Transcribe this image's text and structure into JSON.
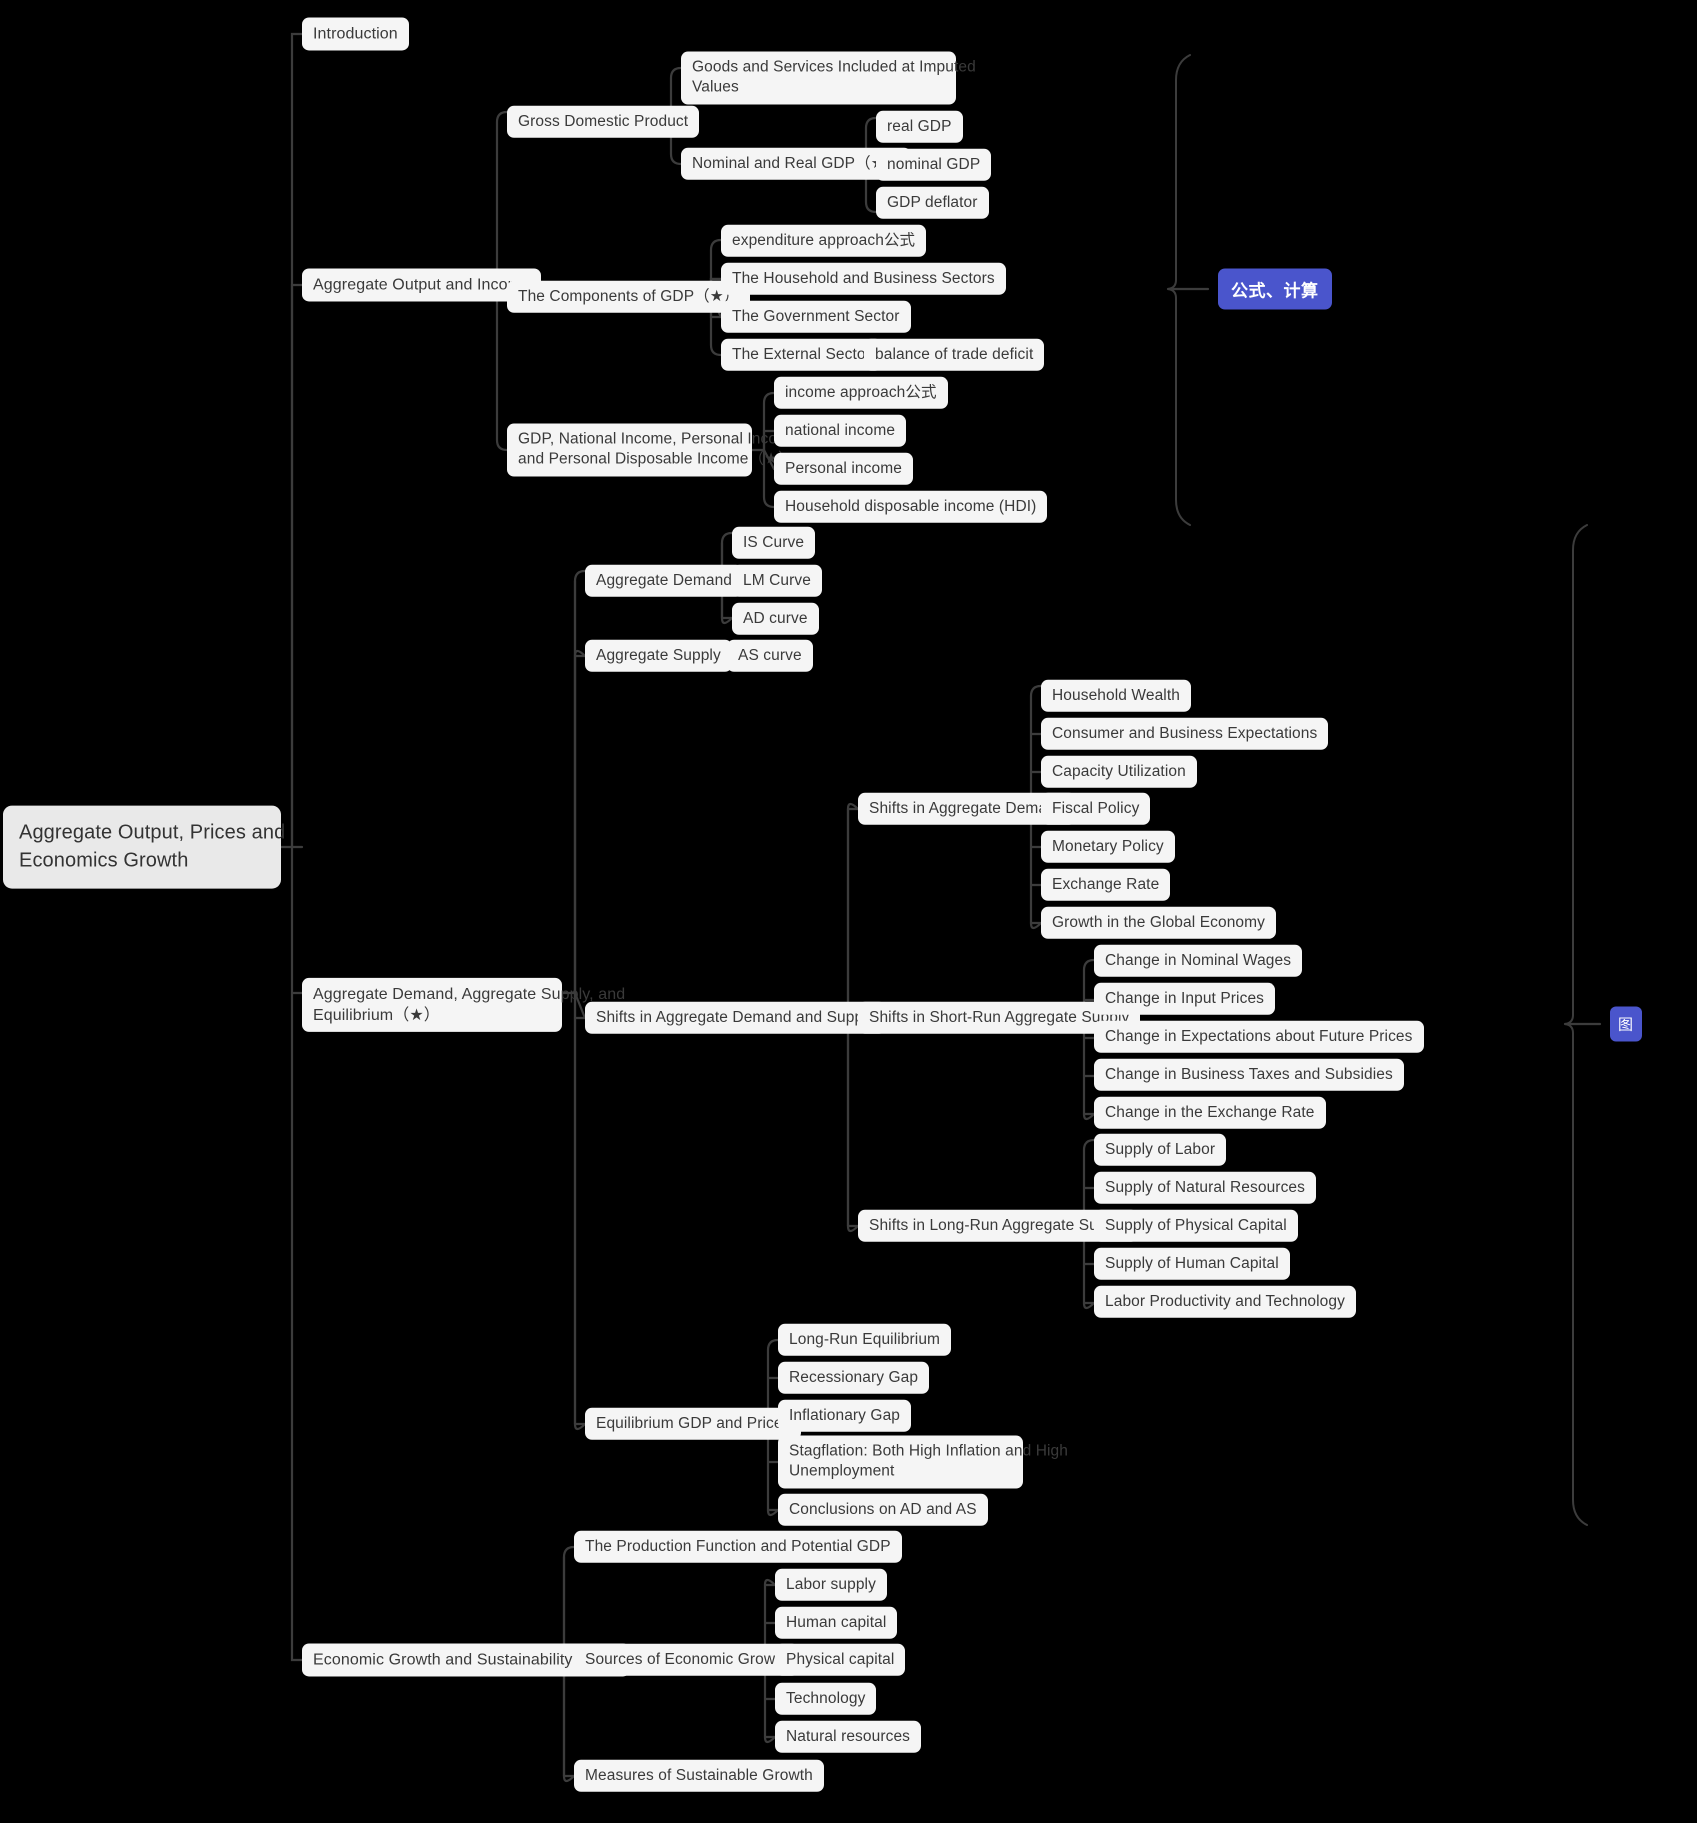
{
  "diagram": {
    "type": "mindmap",
    "background_color": "#000000",
    "node_fill": "#f5f5f5",
    "root_fill": "#e9e9e9",
    "text_color": "#3a3a3a",
    "link_color": "#3c3c3c",
    "badge_color": "#4a55cc",
    "badge_text_color": "#ffffff"
  },
  "root": {
    "label": "Aggregate Output, Prices and\nEconomics Growth"
  },
  "nodes": {
    "introduction": "Introduction",
    "aggregate_output_income": "Aggregate Output and Income",
    "gross_domestic_product": "Gross Domestic Product",
    "goods_services_imputed": "Goods and Services Included at Imputed\nValues",
    "nominal_real_gdp": "Nominal and Real GDP（★）",
    "real_gdp": "real GDP",
    "nominal_gdp": "nominal GDP",
    "gdp_deflator": "GDP deflator",
    "components_of_gdp": "The Components of GDP（★）",
    "expenditure_approach": "expenditure approach公式",
    "household_business_sectors": "The Household and Business Sectors",
    "government_sector": "The Government Sector",
    "external_sector": "The External Sector",
    "balance_of_trade_deficit": "balance of trade deficit",
    "gdp_national_personal": "GDP, National Income, Personal Income,\nand Personal Disposable Income（★）",
    "income_approach": "income approach公式",
    "national_income": "national income",
    "personal_income": "Personal income",
    "household_disposable_income": "Household disposable income (HDI)",
    "ad_as_equilibrium": "Aggregate Demand, Aggregate Supply, and\nEquilibrium（★）",
    "aggregate_demand": "Aggregate Demand",
    "is_curve": "IS Curve",
    "lm_curve": "LM Curve",
    "ad_curve": "AD curve",
    "aggregate_supply": "Aggregate Supply",
    "as_curve": "AS curve",
    "shifts_ad_as": "Shifts in Aggregate Demand and Supply",
    "shifts_in_ad": "Shifts in Aggregate Demand",
    "household_wealth": "Household Wealth",
    "consumer_business_expectations": "Consumer and Business Expectations",
    "capacity_utilization": "Capacity Utilization",
    "fiscal_policy": "Fiscal Policy",
    "monetary_policy": "Monetary Policy",
    "exchange_rate": "Exchange Rate",
    "growth_global_economy": "Growth in the Global Economy",
    "shifts_in_sras": "Shifts in Short-Run Aggregate Supply",
    "change_nominal_wages": "Change in Nominal Wages",
    "change_input_prices": "Change in Input Prices",
    "change_expectations_future_prices": "Change in Expectations about Future Prices",
    "change_business_taxes_subsidies": "Change in Business Taxes and Subsidies",
    "change_the_exchange_rate": "Change in the Exchange Rate",
    "shifts_in_lras": "Shifts in Long-Run Aggregate Supply",
    "supply_of_labor": "Supply of Labor",
    "supply_natural_resources": "Supply of Natural Resources",
    "supply_physical_capital": "Supply of Physical Capital",
    "supply_human_capital": "Supply of Human Capital",
    "labor_productivity_technology": "Labor Productivity and Technology",
    "equilibrium_gdp_prices": "Equilibrium GDP and Prices",
    "long_run_equilibrium": "Long-Run Equilibrium",
    "recessionary_gap": "Recessionary Gap",
    "inflationary_gap": "Inflationary Gap",
    "stagflation": "Stagflation: Both High Inflation and High\nUnemployment",
    "conclusions_ad_as": "Conclusions on AD and AS",
    "economic_growth_sustainability": "Economic Growth and Sustainability（★）",
    "production_function_potential_gdp": "The Production Function and Potential GDP",
    "sources_economic_growth": "Sources of Economic Growth",
    "labor_supply": "Labor supply",
    "human_capital": "Human capital",
    "physical_capital": "Physical capital",
    "technology": "Technology",
    "natural_resources": "Natural resources",
    "measures_sustainable_growth": "Measures of Sustainable Growth"
  },
  "badges": {
    "formula_calculation": "公式、计算",
    "diagram_marker": "图"
  }
}
